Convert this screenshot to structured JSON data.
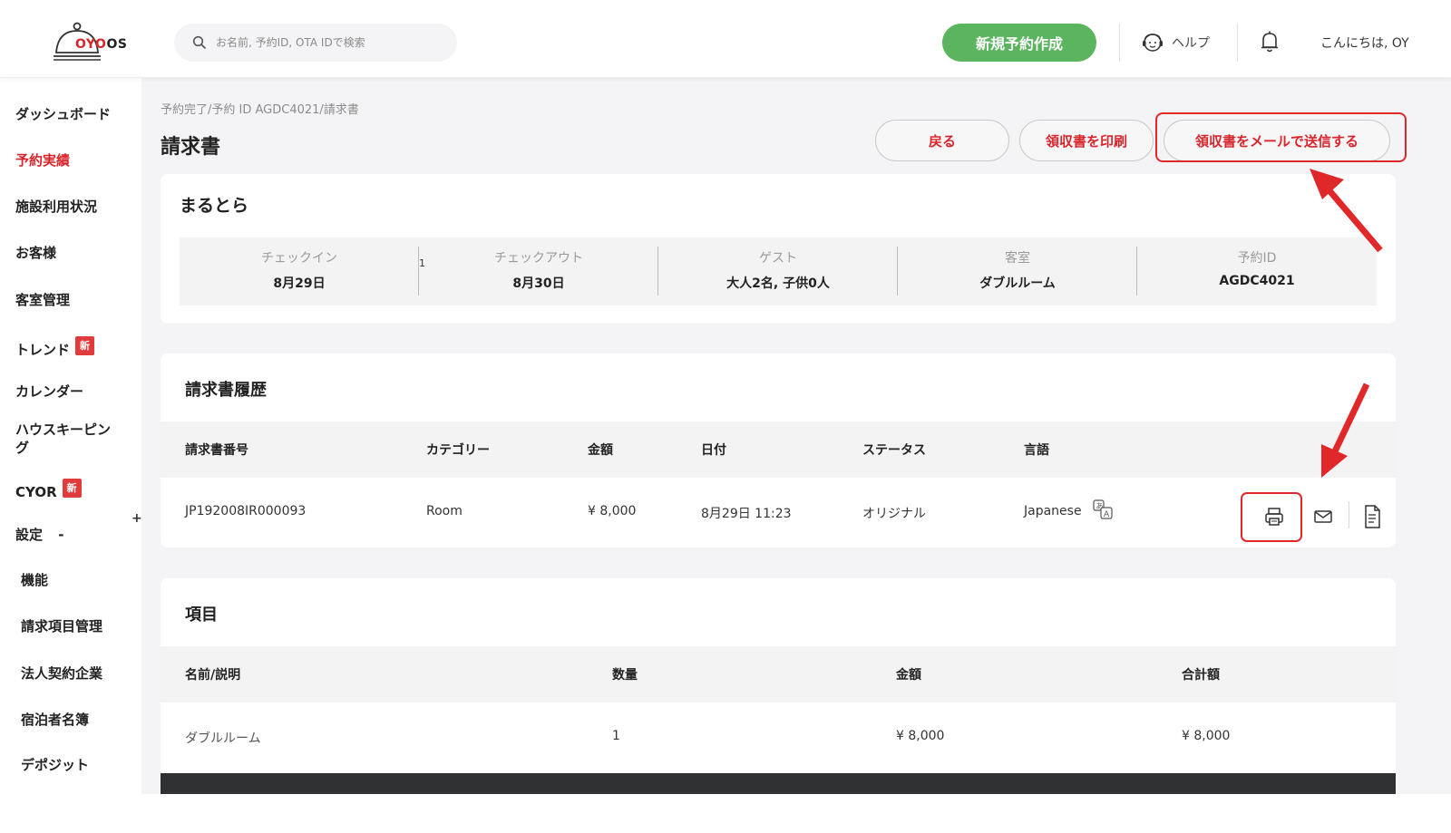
{
  "header": {
    "logo_word": "OYO",
    "logo_suffix": "OS",
    "search_placeholder": "お名前, 予約ID, OTA IDで検索",
    "new_booking_label": "新規予約作成",
    "help_label": "ヘルプ",
    "greeting": "こんにちは, OY"
  },
  "sidebar": {
    "items": [
      {
        "label": "ダッシュボード"
      },
      {
        "label": "予約実績"
      },
      {
        "label": "施設利用状況"
      },
      {
        "label": "お客様"
      },
      {
        "label": "客室管理"
      },
      {
        "label": "トレンド",
        "badge": "新"
      },
      {
        "label": "カレンダー"
      },
      {
        "label": "ハウスキーピン",
        "label2": "グ",
        "expander": "+"
      },
      {
        "label": "CYOR",
        "badge": "新"
      },
      {
        "label": "設定",
        "expander": "-"
      },
      {
        "label": "機能"
      },
      {
        "label": "請求項目管理"
      },
      {
        "label": "法人契約企業"
      },
      {
        "label": "宿泊者名簿"
      },
      {
        "label": "デポジット"
      }
    ]
  },
  "page": {
    "breadcrumb": "予約完了/予約 ID AGDC4021/請求書",
    "title": "請求書",
    "buttons": {
      "back": "戻る",
      "print_receipt": "領収書を印刷",
      "email_receipt": "領収書をメールで送信する"
    }
  },
  "booking": {
    "hotel_name": "まるとら",
    "stray_mark": "1",
    "fields": [
      {
        "label": "チェックイン",
        "value": "8月29日"
      },
      {
        "label": "チェックアウト",
        "value": "8月30日"
      },
      {
        "label": "ゲスト",
        "value": "大人2名, 子供0人"
      },
      {
        "label": "客室",
        "value": "ダブルルーム"
      },
      {
        "label": "予約ID",
        "value": "AGDC4021"
      }
    ]
  },
  "invoice_history": {
    "title": "請求書履歴",
    "columns": [
      "請求書番号",
      "カテゴリー",
      "金額",
      "日付",
      "ステータス",
      "言語"
    ],
    "rows": [
      {
        "number": "JP192008IR000093",
        "category": "Room",
        "amount": "¥ 8,000",
        "date": "8月29日 11:23",
        "status": "オリジナル",
        "language": "Japanese"
      }
    ]
  },
  "items": {
    "title": "項目",
    "columns": [
      "名前/説明",
      "数量",
      "金額",
      "合計額"
    ],
    "rows": [
      {
        "name": "ダブルルーム",
        "quantity": "1",
        "amount": "¥ 8,000",
        "total": "¥ 8,000"
      }
    ]
  },
  "colors": {
    "accent_red": "#d9262c",
    "primary_green": "#5ab55e",
    "annotation_red": "#e0282b"
  }
}
